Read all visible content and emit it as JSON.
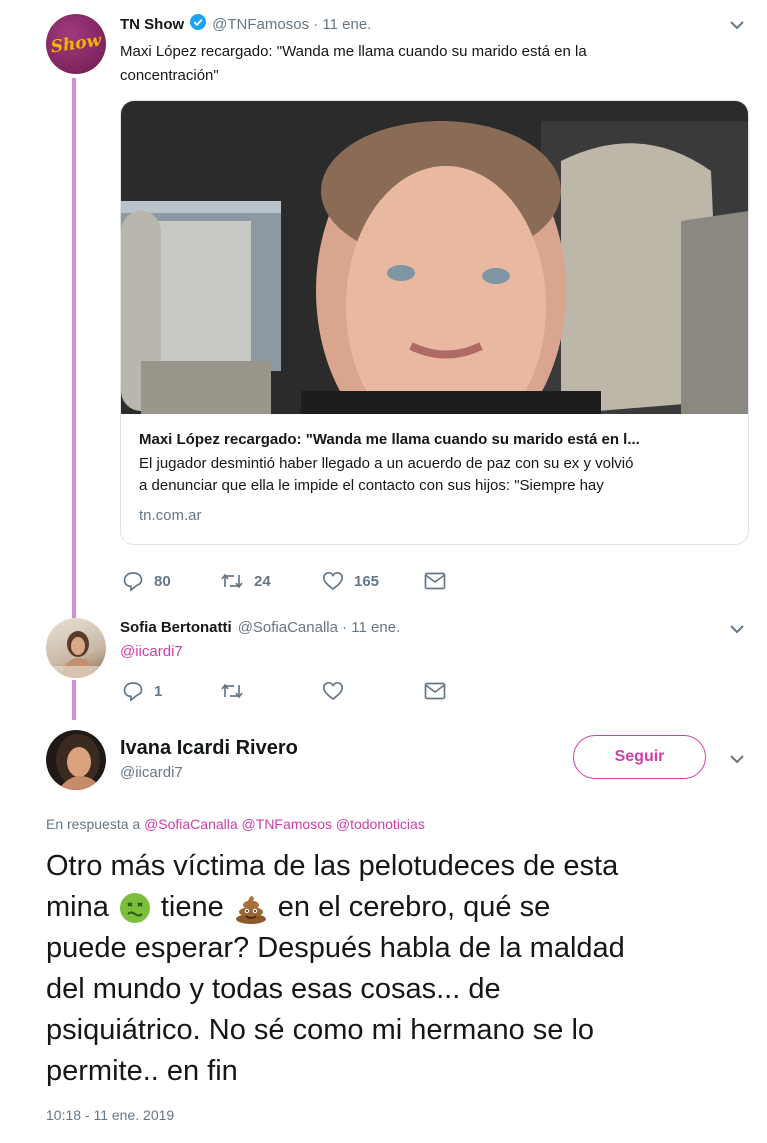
{
  "tweet1": {
    "name": "TN Show",
    "avatar_text": "Show",
    "handle_time": "@TNFamosos · 11 ene.",
    "text_line1": "Maxi López recargado: \"Wanda me llama cuando su marido está en la",
    "text_line2": "concentración\"",
    "card": {
      "title": "Maxi López recargado: \"Wanda me llama cuando su marido está en l...",
      "desc_line1": "El jugador desmintió haber llegado a un acuerdo de paz con su ex y volvió",
      "desc_line2": "a denunciar que ella le impide el contacto con sus hijos: \"Siempre hay",
      "domain": "tn.com.ar"
    },
    "actions": {
      "replies": "80",
      "retweets": "24",
      "likes": "165"
    }
  },
  "tweet2": {
    "name": "Sofia Bertonatti",
    "handle_time": "@SofiaCanalla · 11 ene.",
    "text": "@iicardi7",
    "actions": {
      "replies": "1"
    }
  },
  "tweet3": {
    "name": "Ivana Icardi Rivero",
    "handle": "@iicardi7",
    "follow_label": "Seguir",
    "reply_prefix": "En respuesta a",
    "reply_to": "@SofiaCanalla @TNFamosos @todonoticias",
    "line1": "Otro más víctima de las pelotudeces de esta",
    "line2a": "mina",
    "line2b": "tiene",
    "line2c": "en el cerebro, qué se",
    "line3": "puede esperar? Después habla de la maldad",
    "line4": "del mundo y todas esas cosas... de",
    "line5": "psiquiátrico. No sé como mi hermano se lo",
    "line6": "permite.. en fin",
    "timestamp": "10:18 - 11 ene. 2019"
  },
  "colors": {
    "accent": "#d03ea8",
    "thread": "#d58ad8",
    "muted": "#657786"
  }
}
